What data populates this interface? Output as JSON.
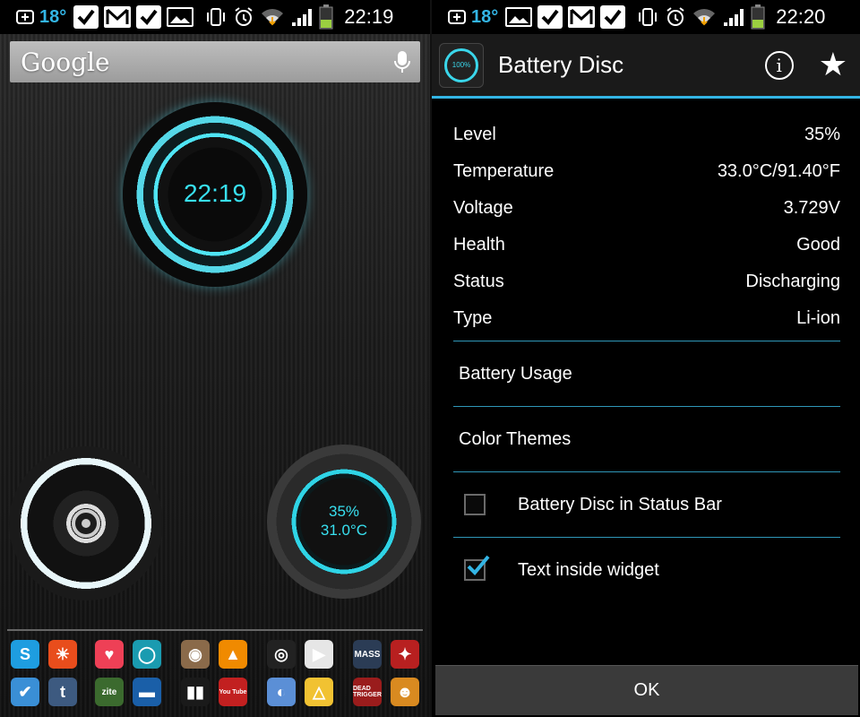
{
  "left_status": {
    "temperature": "18°",
    "time": "22:19"
  },
  "right_status": {
    "temperature": "18°",
    "time": "22:20"
  },
  "home": {
    "search_brand": "Google",
    "clock_widget_time": "22:19",
    "battery_widget_level": "35%",
    "battery_widget_temp": "31.0°C"
  },
  "dock_apps": [
    {
      "name": "skype-app-icon",
      "label": "S",
      "color": "#1e9de0"
    },
    {
      "name": "weather-app-icon",
      "label": "☀",
      "color": "#e84d1c"
    },
    {
      "name": "pocket-app-icon",
      "label": "♥",
      "color": "#ee4056"
    },
    {
      "name": "circle-app-icon",
      "label": "◯",
      "color": "#1a9bb0"
    },
    {
      "name": "instagram-app-icon",
      "label": "◉",
      "color": "#8a6a4a"
    },
    {
      "name": "vlc-app-icon",
      "label": "▲",
      "color": "#f08a00"
    },
    {
      "name": "battery-disc-app-icon",
      "label": "◎",
      "color": "#222222"
    },
    {
      "name": "play-store-app-icon",
      "label": "▶",
      "color": "#e6e6e6"
    },
    {
      "name": "mass-effect-app-icon",
      "label": "MASS",
      "color": "#2b3c55"
    },
    {
      "name": "game-app-icon",
      "label": "✦",
      "color": "#b82020"
    },
    {
      "name": "tasks-app-icon",
      "label": "✔",
      "color": "#3a8fd6"
    },
    {
      "name": "tumblr-app-icon",
      "label": "t",
      "color": "#3d5a80"
    },
    {
      "name": "zite-app-icon",
      "label": "zite",
      "color": "#3b6a2e"
    },
    {
      "name": "transit-app-icon",
      "label": "▬",
      "color": "#1a5fa8"
    },
    {
      "name": "equalizer-app-icon",
      "label": "▮▮",
      "color": "#1a1a1a"
    },
    {
      "name": "youtube-app-icon",
      "label": "You Tube",
      "color": "#c22020"
    },
    {
      "name": "folder-app-icon",
      "label": "◐",
      "color": "#5b8fd6"
    },
    {
      "name": "drive-app-icon",
      "label": "△",
      "color": "#f1c232"
    },
    {
      "name": "dead-trigger-app-icon",
      "label": "DEAD TRIGGER",
      "color": "#9a1c1c"
    },
    {
      "name": "perry-app-icon",
      "label": "☻",
      "color": "#d98a20"
    }
  ],
  "app": {
    "title": "Battery Disc",
    "icon_text": "100%",
    "stats": [
      {
        "label": "Level",
        "value": "35%"
      },
      {
        "label": "Temperature",
        "value": "33.0°C/91.40°F"
      },
      {
        "label": "Voltage",
        "value": "3.729V"
      },
      {
        "label": "Health",
        "value": "Good"
      },
      {
        "label": "Status",
        "value": "Discharging"
      },
      {
        "label": "Type",
        "value": "Li-ion"
      }
    ],
    "menu": {
      "battery_usage": "Battery Usage",
      "color_themes": "Color Themes"
    },
    "options": {
      "status_bar_label": "Battery Disc in Status Bar",
      "status_bar_checked": false,
      "text_widget_label": "Text inside widget",
      "text_widget_checked": true
    },
    "ok_label": "OK"
  },
  "colors": {
    "accent": "#33b5e5",
    "widget_cyan": "#38e0f0"
  }
}
